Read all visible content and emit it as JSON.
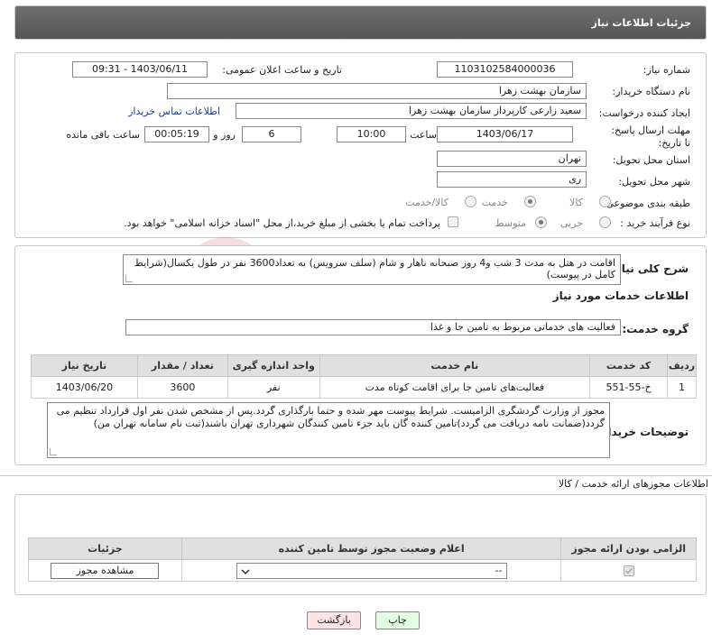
{
  "page": {
    "title": "جزئیات اطلاعات نیاز"
  },
  "labels": {
    "need_number": "شماره نیاز:",
    "announce_datetime": "تاریخ و ساعت اعلان عمومی:",
    "buyer_org": "نام دستگاه خریدار:",
    "requester": "ایجاد کننده درخواست:",
    "contact_link": "اطلاعات تماس خریدار",
    "deadline": "مهلت ارسال پاسخ: تا تاریخ:",
    "time_word": "ساعت",
    "days_word": "روز و",
    "remaining": "ساعت باقی مانده",
    "province": "استان محل تحویل:",
    "city": "شهر محل تحویل:",
    "category": "طبقه بندی موضوعی:",
    "process_type": "نوع فرآیند خرید :",
    "payment_note": "پرداخت تمام یا بخشی از مبلغ خرید،از محل \"اسناد خزانه اسلامی\" خواهد بود.",
    "general_desc": "شرح کلی نیاز:",
    "services_info": "اطلاعات خدمات مورد نیاز",
    "service_group": "گروه خدمت:",
    "buyer_notes": "توضیحات خریدار:",
    "permits_title": "اطلاعات مجوزهای ارائه خدمت / کالا"
  },
  "values": {
    "need_number": "1103102584000036",
    "announce_datetime": "1403/06/11 - 09:31",
    "buyer_org": "سازمان بهشت زهرا",
    "requester": "سعید زارعی کارپرداز سازمان بهشت زهرا",
    "deadline_date": "1403/06/17",
    "deadline_time": "10:00",
    "days_left": "6",
    "time_left": "00:05:19",
    "province": "تهران",
    "city": "ری",
    "general_desc": "اقامت در هتل به مدت 3 شب و4 روز صبحانه ناهار و شام (سلف سرویس) به تعداد3600 نفر در طول یکسال(شرایط کامل در پیوست)",
    "service_group": "فعالیت های خدماتی مربوط به تامین جا و غذا",
    "buyer_notes": "مجوز از وزارت گردشگری الزامیست. شرایط پیوست مهر شده و حتما بارگذاری گردد.پس از مشخص شدن نفر اول قرارداد تنظیم می گردد(ضمانت نامه دریافت می گردد)تامین کننده گان باید جزء تامین کنندگان شهرداری تهران باشند(ثبت نام سامانه تهران من)"
  },
  "category_options": [
    {
      "label": "کالا",
      "selected": false
    },
    {
      "label": "خدمت",
      "selected": true
    },
    {
      "label": "کالا/خدمت",
      "selected": false
    }
  ],
  "process_options": [
    {
      "label": "جزیی",
      "selected": false
    },
    {
      "label": "متوسط",
      "selected": true
    }
  ],
  "services_table": {
    "headers": [
      "ردیف",
      "کد خدمت",
      "نام خدمت",
      "واحد اندازه گیری",
      "تعداد / مقدار",
      "تاریخ نیاز"
    ],
    "rows": [
      [
        "1",
        "خ-55-551",
        "فعالیت‌های تامین جا برای اقامت کوتاه مدت",
        "نفر",
        "3600",
        "1403/06/20"
      ]
    ]
  },
  "permits_table": {
    "headers": [
      "الزامی بودن ارائه مجوز",
      "اعلام وضعیت مجوز توسط تامین کننده",
      "جزئیات"
    ],
    "select_value": "--",
    "view_button": "مشاهده مجوز"
  },
  "buttons": {
    "print": "چاپ",
    "back": "بازگشت"
  },
  "watermark": "AriaTender.neT",
  "colors": {
    "header_bg": "#5f5f5f",
    "link": "#1a3fa0",
    "back_btn": "#fde3e3",
    "print_btn": "#e3fde3"
  }
}
